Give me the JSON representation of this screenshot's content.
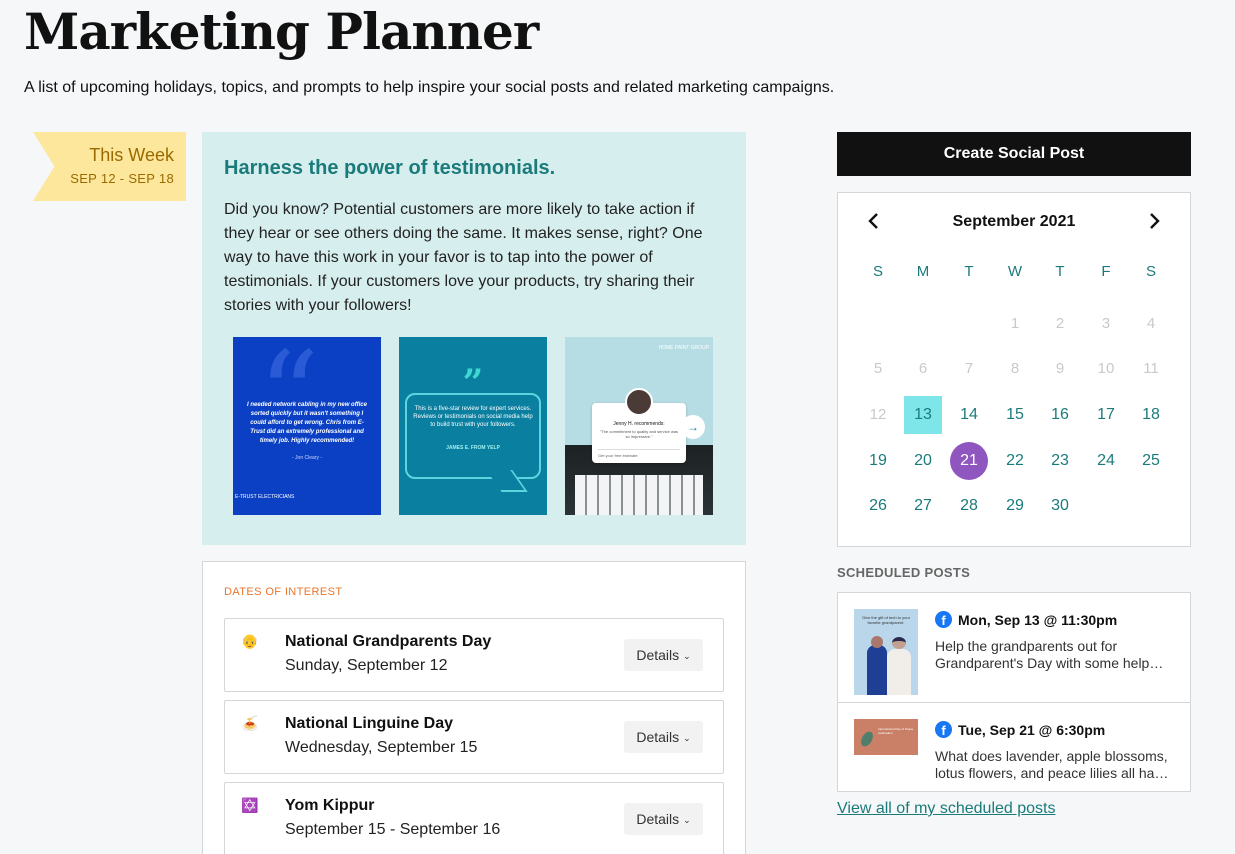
{
  "header": {
    "title": "Marketing Planner",
    "subtitle": "A list of upcoming holidays, topics, and prompts to help inspire your social posts and related marketing campaigns."
  },
  "week": {
    "label": "This Week",
    "range": "SEP 12 - SEP 18"
  },
  "topic": {
    "title": "Harness the power of testimonials.",
    "body": "Did you know? Potential customers are more likely to take action if they hear or see others doing the same. It makes sense, right? One way to have this work in your favor is to tap into the power of testimonials. If your customers love your products, try sharing their stories with your followers!",
    "examples": [
      {
        "quote": "I needed network cabling in my new office sorted quickly but it wasn't something I could afford to get wrong. Chris from E-Trust did an extremely professional and timely job. Highly recommended!",
        "author": "- Jon Cleary -",
        "brand": "E-TRUST ELECTRICIANS"
      },
      {
        "quote": "This is a five-star review for expert services. Reviews or testimonials on social media help to build trust with your followers.",
        "author": "JAMES E. FROM YELP"
      },
      {
        "logo": "HOME PAINT GROUP",
        "name": "Jenny H. recommends:",
        "recommendation": "\"The commitment to quality and service was so impressive.\"",
        "cta": "Get your free estimate"
      }
    ]
  },
  "dates_of_interest": {
    "heading": "DATES OF INTEREST",
    "details_label": "Details",
    "items": [
      {
        "emoji": "👴",
        "name": "National Grandparents Day",
        "date": "Sunday, September 12"
      },
      {
        "emoji": "🍝",
        "name": "National Linguine Day",
        "date": "Wednesday, September 15"
      },
      {
        "emoji": "✡️",
        "name": "Yom Kippur",
        "date": "September 15 - September 16"
      }
    ]
  },
  "create_button": "Create Social Post",
  "calendar": {
    "month": "September 2021",
    "weekdays": [
      "S",
      "M",
      "T",
      "W",
      "T",
      "F",
      "S"
    ],
    "first_weekday_index": 3,
    "days_in_month": 30,
    "past_through_day": 12,
    "selected_day": 13,
    "today": 21
  },
  "scheduled": {
    "heading": "SCHEDULED POSTS",
    "posts": [
      {
        "time": "Mon, Sep 13 @ 11:30pm",
        "text": "Help the grandparents out for Grandparent's Day with some help with technology at your store.",
        "thumb_text": "Give the gift of tech to your favorite grandparent."
      },
      {
        "time": "Tue, Sep 21 @ 6:30pm",
        "text": "What does lavender, apple blossoms, lotus flowers, and peace lilies all have in common?",
        "thumb_text": "International Day of Peace celebration"
      }
    ],
    "view_all": "View all of my scheduled posts"
  },
  "colors": {
    "accent_teal": "#1b7b7b",
    "topic_bg": "#d7eeee",
    "ribbon_bg": "#fde79c",
    "today_purple": "#8e56be",
    "selected_cyan": "#7ee6e8",
    "facebook_blue": "#1877f2"
  }
}
